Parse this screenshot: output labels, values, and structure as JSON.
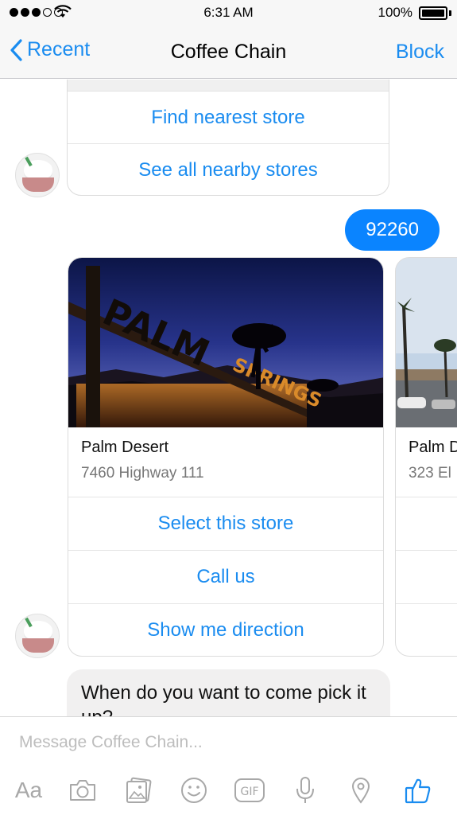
{
  "status_bar": {
    "time": "6:31 AM",
    "battery": "100%"
  },
  "nav": {
    "back_label": "Recent",
    "title": "Coffee Chain",
    "action_label": "Block"
  },
  "quick_replies": [
    "Find nearest store",
    "See all nearby stores"
  ],
  "user_message": "92260",
  "stores": [
    {
      "name": "Palm Desert",
      "address": "7460 Highway 111",
      "buttons": [
        "Select this store",
        "Call us",
        "Show me direction"
      ]
    },
    {
      "name": "Palm D",
      "address": "323 El"
    }
  ],
  "bot_message": "When do you want to come pick it up?",
  "composer": {
    "placeholder": "Message Coffee Chain...",
    "toolbar": [
      "Aa",
      "camera-icon",
      "gallery-icon",
      "emoji-icon",
      "GIF",
      "microphone-icon",
      "location-icon",
      "thumbs-up-icon"
    ]
  },
  "colors": {
    "accent": "#1a8cf0",
    "user_bubble": "#0a84ff",
    "bot_bubble": "#f1f0f0"
  }
}
